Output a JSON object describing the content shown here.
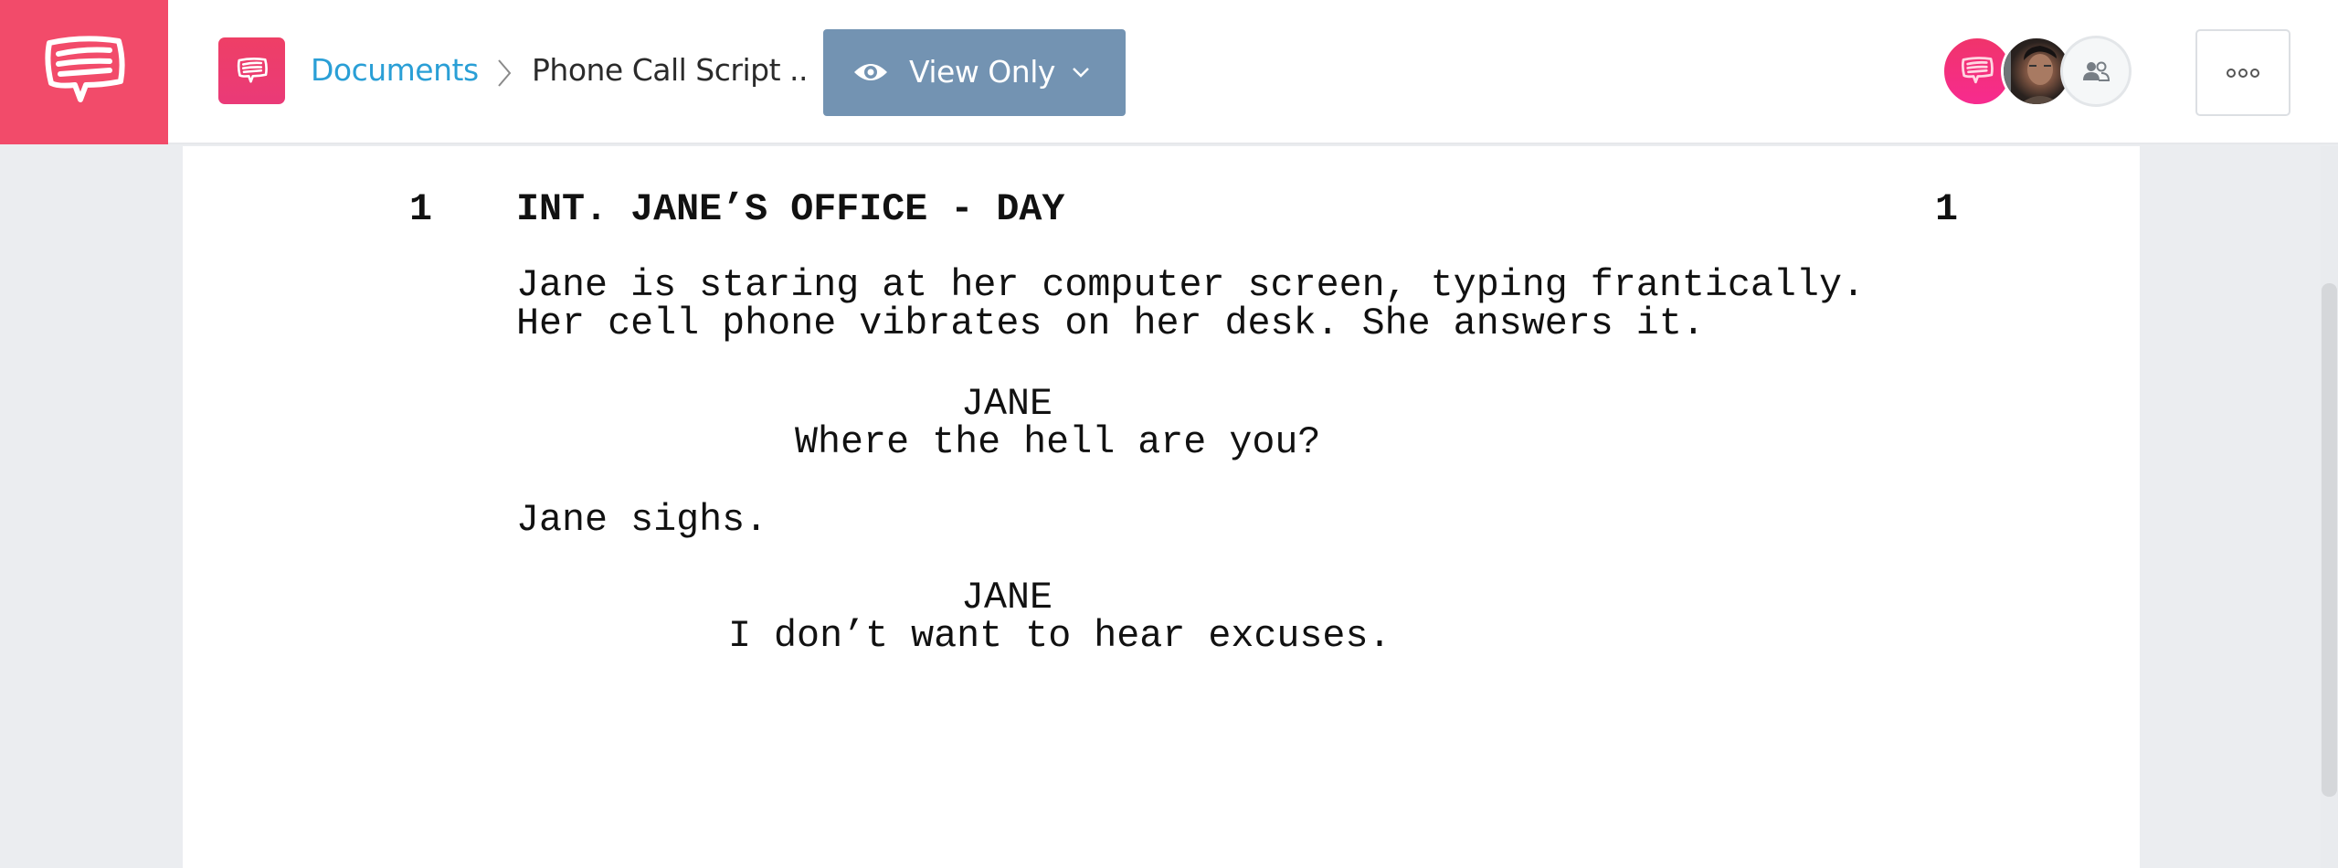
{
  "header": {
    "logo_icon": "speech-bubble-icon",
    "doc_icon": "speech-bubble-icon",
    "breadcrumb": {
      "root": "Documents",
      "separator_icon": "chevron-right-icon",
      "current": "Phone Call Script .."
    },
    "view_mode": {
      "icon": "eye-icon",
      "label": "View Only",
      "dropdown_icon": "chevron-down-icon"
    },
    "collaborators": [
      {
        "type": "brand",
        "icon": "speech-bubble-icon"
      },
      {
        "type": "photo",
        "icon": "user-photo"
      },
      {
        "type": "add",
        "icon": "people-icon"
      }
    ],
    "more_icon": "more-horizontal-icon"
  },
  "colors": {
    "brand": "#f24b6a",
    "link": "#2a9fd6",
    "view_button": "#7393b2"
  },
  "script": {
    "scene_number": "1",
    "scene_heading": "INT. JANE’S OFFICE - DAY",
    "action_1": [
      "Jane is staring at her computer screen, typing frantically.",
      "Her cell phone vibrates on her desk. She answers it."
    ],
    "character_1": "JANE",
    "dialogue_1": "Where the hell are you?",
    "action_2": "Jane sighs.",
    "character_2": "JANE",
    "dialogue_2": "I don’t want to hear excuses."
  }
}
